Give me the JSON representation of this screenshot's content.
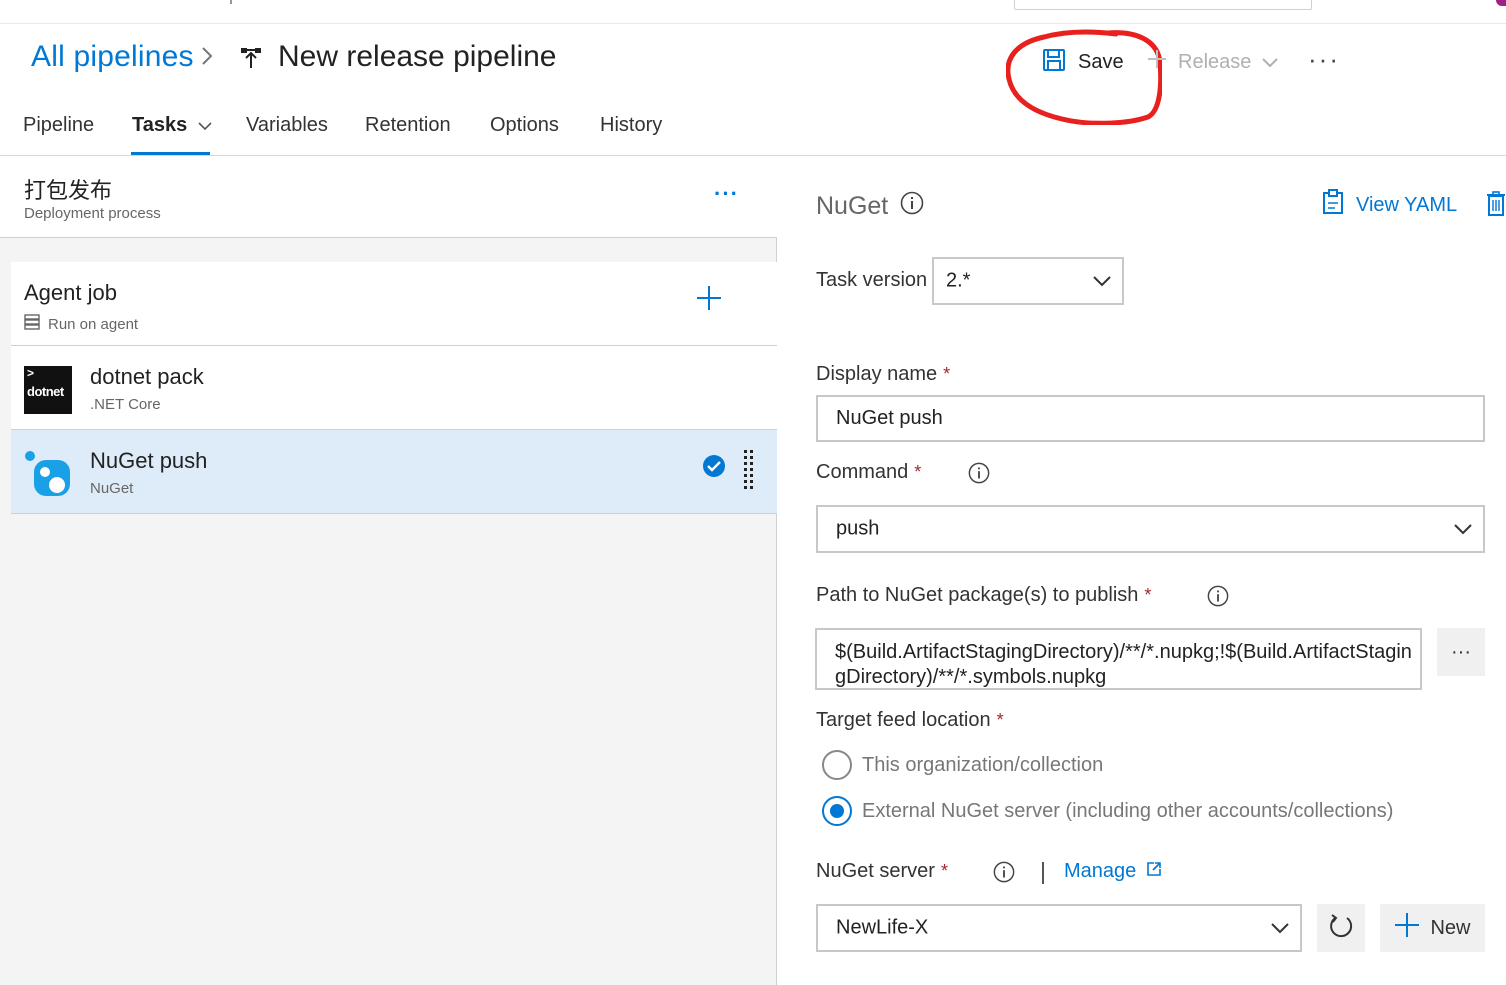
{
  "header": {
    "breadcrumb_link": "All pipelines",
    "breadcrumb_sep": ">",
    "title": "New release pipeline",
    "save_label": "Save",
    "release_label": "Release",
    "more_label": "···"
  },
  "tabs": [
    {
      "label": "Pipeline"
    },
    {
      "label": "Tasks"
    },
    {
      "label": "Variables"
    },
    {
      "label": "Retention"
    },
    {
      "label": "Options"
    },
    {
      "label": "History"
    }
  ],
  "stage": {
    "name": "打包发布",
    "subtitle": "Deployment process",
    "more_label": "···"
  },
  "agent_job": {
    "title": "Agent job",
    "subtitle": "Run on agent"
  },
  "tasks": [
    {
      "title": "dotnet pack",
      "subtitle": ".NET Core",
      "icon_label": "dotnet",
      "icon_prompt": ">"
    },
    {
      "title": "NuGet push",
      "subtitle": "NuGet"
    }
  ],
  "detail": {
    "heading": "NuGet",
    "view_yaml_label": "View YAML",
    "task_version_label": "Task version",
    "task_version_value": "2.*",
    "display_name_label": "Display name",
    "display_name_value": "NuGet push",
    "required_mark": "*",
    "command_label": "Command",
    "command_value": "push",
    "path_label": "Path to NuGet package(s) to publish",
    "path_value": "$(Build.ArtifactStagingDirectory)/**/*.nupkg;!$(Build.ArtifactStagingDirectory)/**/*.symbols.nupkg",
    "path_more_label": "···",
    "target_feed_label": "Target feed location",
    "radio_org": "This organization/collection",
    "radio_external": "External NuGet server (including other accounts/collections)",
    "nuget_server_label": "NuGet server",
    "manage_label": "Manage",
    "nuget_server_value": "NewLife-X",
    "new_label": "New"
  },
  "colors": {
    "accent": "#0078d4",
    "selected_row": "#deecf9",
    "annotation_red": "#e8201e",
    "required": "#a4262c"
  }
}
